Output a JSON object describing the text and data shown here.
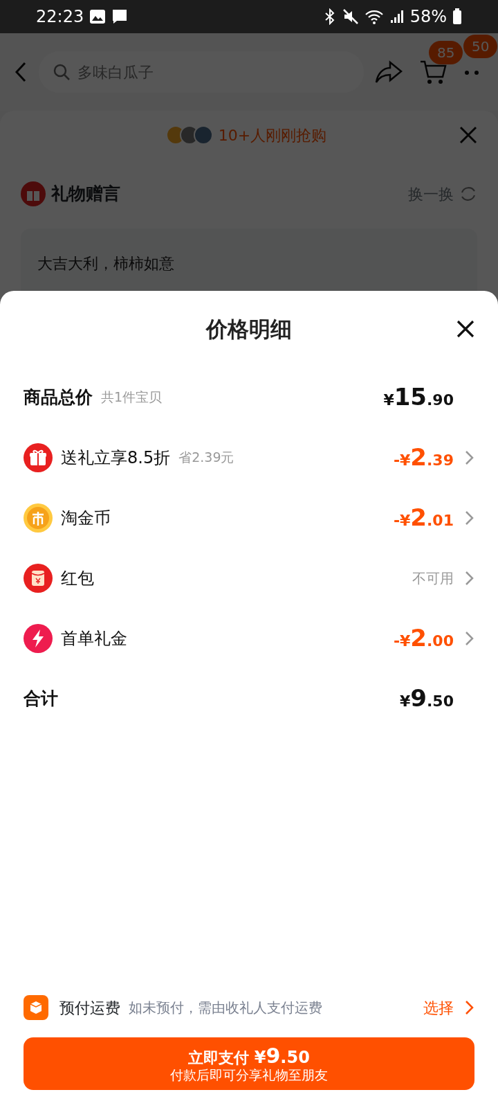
{
  "status_bar": {
    "time": "22:23",
    "battery": "58%"
  },
  "header": {
    "search_placeholder": "多味白瓜子",
    "badges": [
      "85",
      "50"
    ]
  },
  "gift_sheet": {
    "buyers": "10+人刚刚抢购",
    "message_title": "礼物赠言",
    "shuffle": "换一换",
    "message": "大吉大利，柿柿如意"
  },
  "price_sheet": {
    "title": "价格明细",
    "total": {
      "label": "商品总价",
      "note": "共1件宝贝",
      "amount": {
        "sign": "¥",
        "main": "15",
        "fraction": ".90"
      }
    },
    "rows": [
      {
        "kind": "amount",
        "label": "送礼立享8.5折",
        "note": "省2.39元",
        "amount": {
          "sign": "-¥",
          "main": "2",
          "fraction": ".39"
        }
      },
      {
        "kind": "amount",
        "label": "淘金币",
        "amount": {
          "sign": "-¥",
          "main": "2",
          "fraction": ".01"
        }
      },
      {
        "kind": "text",
        "label": "红包",
        "value": "不可用"
      },
      {
        "kind": "amount",
        "label": "首单礼金",
        "amount": {
          "sign": "-¥",
          "main": "2",
          "fraction": ".00"
        }
      }
    ],
    "sum": {
      "label": "合计",
      "amount": {
        "sign": "¥",
        "main": "9",
        "fraction": ".50"
      }
    },
    "shipping": {
      "label": "预付运费",
      "note": "如未预付，需由收礼人支付运费",
      "action": "选择"
    },
    "pay_button": {
      "label": "立即支付",
      "amount": {
        "sign": "¥",
        "main": "9",
        "fraction": ".50"
      },
      "subtitle": "付款后即可分享礼物至朋友"
    }
  }
}
